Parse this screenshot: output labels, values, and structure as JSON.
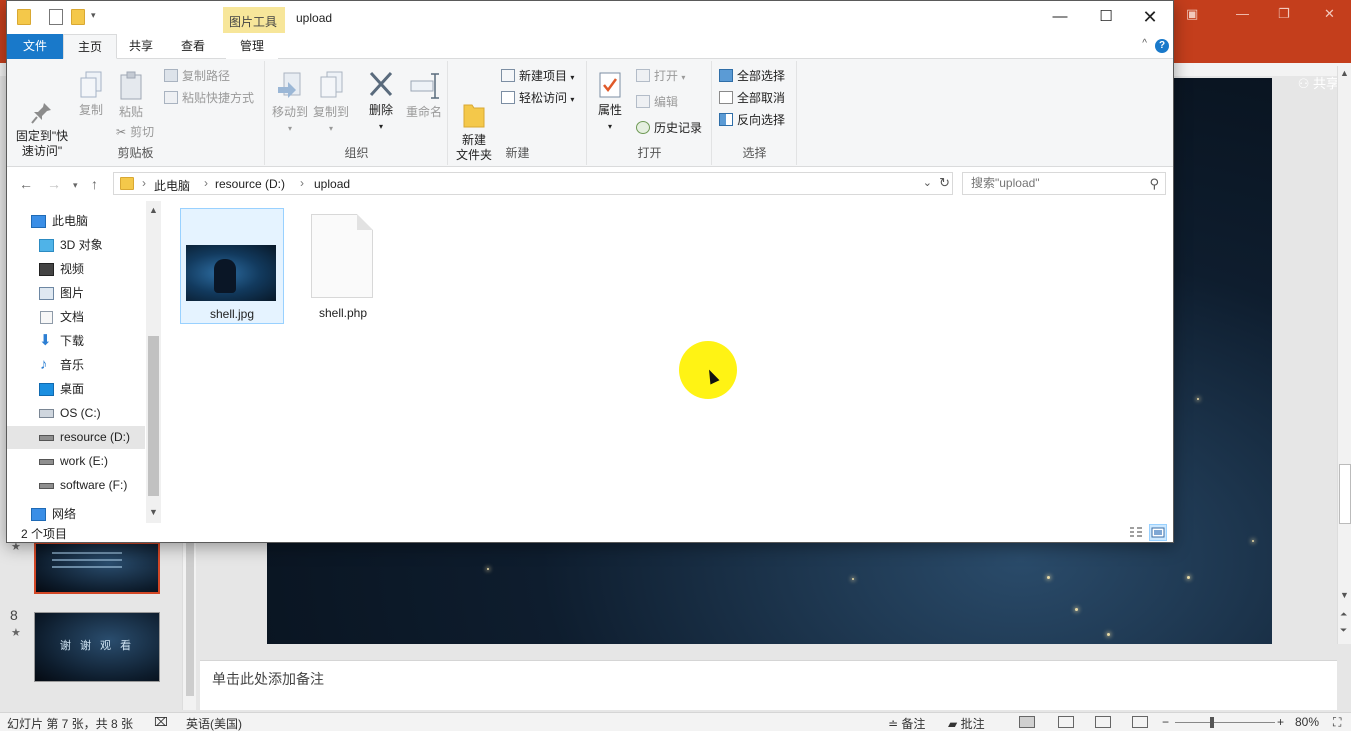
{
  "powerpoint": {
    "share_label": "共享",
    "notes_placeholder": "单击此处添加备注",
    "slides": [
      {
        "number": "",
        "star": "★"
      },
      {
        "number": "8",
        "star": "★",
        "text": "谢 谢 观 看"
      }
    ],
    "status": {
      "slide_info": "幻灯片 第 7 张，共 8 张",
      "language": "英语(美国)",
      "notes_label": "备注",
      "comments_label": "批注",
      "zoom": "80%"
    }
  },
  "explorer": {
    "context_tab": "图片工具",
    "window_title": "upload",
    "tabs": {
      "file": "文件",
      "home": "主页",
      "share": "共享",
      "view": "查看",
      "manage": "管理"
    },
    "ribbon": {
      "clipboard": {
        "label": "剪贴板",
        "pin": "固定到\"快\n速访问\"",
        "copy": "复制",
        "paste": "粘贴",
        "copy_path": "复制路径",
        "paste_shortcut": "粘贴快捷方式",
        "cut": "剪切"
      },
      "organize": {
        "label": "组织",
        "move_to": "移动到",
        "copy_to": "复制到",
        "delete": "删除",
        "rename": "重命名"
      },
      "new": {
        "label": "新建",
        "new_folder": "新建\n文件夹",
        "new_item": "新建项目",
        "easy_access": "轻松访问"
      },
      "open": {
        "label": "打开",
        "properties": "属性",
        "open": "打开",
        "edit": "编辑",
        "history": "历史记录"
      },
      "select": {
        "label": "选择",
        "select_all": "全部选择",
        "select_none": "全部取消",
        "invert": "反向选择"
      }
    },
    "address": {
      "crumbs": [
        "此电脑",
        "resource (D:)",
        "upload"
      ],
      "search_placeholder": "搜索\"upload\""
    },
    "nav": [
      {
        "label": "此电脑",
        "icon": "computer-icon"
      },
      {
        "label": "3D 对象",
        "icon": "3d-objects-icon"
      },
      {
        "label": "视频",
        "icon": "video-icon"
      },
      {
        "label": "图片",
        "icon": "pictures-icon"
      },
      {
        "label": "文档",
        "icon": "documents-icon"
      },
      {
        "label": "下载",
        "icon": "downloads-icon"
      },
      {
        "label": "音乐",
        "icon": "music-icon"
      },
      {
        "label": "桌面",
        "icon": "desktop-icon"
      },
      {
        "label": "OS (C:)",
        "icon": "drive-icon"
      },
      {
        "label": "resource (D:)",
        "icon": "drive-icon"
      },
      {
        "label": "work (E:)",
        "icon": "drive-icon"
      },
      {
        "label": "software (F:)",
        "icon": "drive-icon"
      },
      {
        "label": "网络",
        "icon": "network-icon"
      }
    ],
    "files": [
      {
        "name": "shell.jpg",
        "type": "image"
      },
      {
        "name": "shell.php",
        "type": "document"
      }
    ],
    "status": {
      "item_count": "2 个项目"
    }
  },
  "colors": {
    "ppt_accent": "#c43e1c",
    "explorer_file_tab": "#1979ca",
    "context_tab": "#f7e69a",
    "cursor_highlight": "#fff200"
  }
}
